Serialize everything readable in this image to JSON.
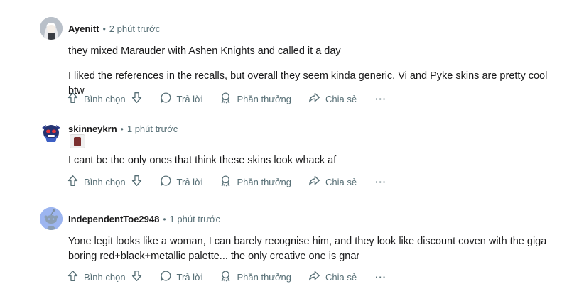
{
  "comments": [
    {
      "author": "Ayenitt",
      "time": "2 phút trước",
      "paragraphs": [
        "they mixed Marauder with Ashen Knights and called it a day",
        "I liked the references in the recalls, but overall they seem kinda generic. Vi and Pyke skins are pretty cool btw"
      ],
      "avatar_icon": "anime-character-avatar"
    },
    {
      "author": "skinneykrn",
      "time": "1 phút trước",
      "paragraphs": [
        "I cant be the only ones that think these skins look whack af"
      ],
      "avatar_icon": "dark-creature-avatar",
      "flair_icon": "champion-flair-icon"
    },
    {
      "author": "IndependentToe2948",
      "time": "1 phút trước",
      "paragraphs": [
        "Yone legit looks like a woman, I can barely recognise him, and they look like discount coven with the giga boring red+black+metallic palette... the only creative one is gnar"
      ],
      "avatar_icon": "default-snoo-avatar"
    }
  ],
  "actions": {
    "vote": "Bình chọn",
    "reply": "Trả lời",
    "award": "Phần thưởng",
    "share": "Chia sẻ",
    "more": "···"
  },
  "separator": "•",
  "colors": {
    "text": "#1a1a1b",
    "meta": "#576f76",
    "snoo_bg": "#9cb5f0"
  }
}
